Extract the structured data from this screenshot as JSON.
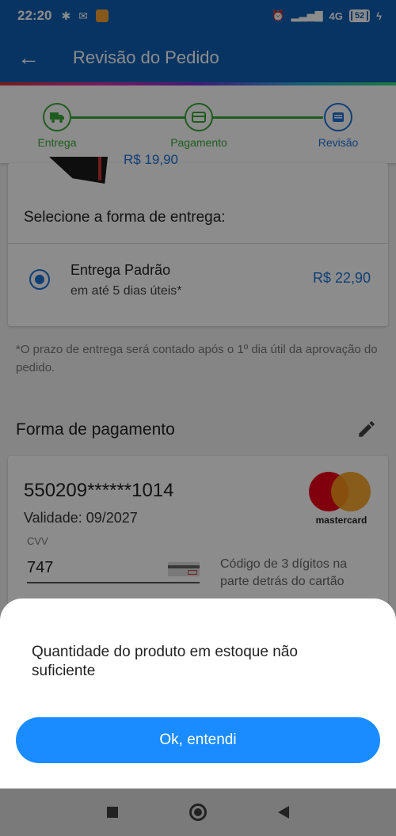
{
  "status_bar": {
    "time": "22:20",
    "network": "4G",
    "battery": "52"
  },
  "app_bar": {
    "title": "Revisão do Pedido"
  },
  "stepper": {
    "steps": [
      {
        "label": "Entrega",
        "state": "done"
      },
      {
        "label": "Pagamento",
        "state": "done"
      },
      {
        "label": "Revisão",
        "state": "current"
      }
    ],
    "colors": {
      "done": "#3aa83a",
      "current": "#1e73d8"
    }
  },
  "delivery": {
    "product_price": "R$ 19,90",
    "heading": "Selecione a forma de entrega:",
    "option": {
      "name": "Entrega Padrão",
      "subtitle": "em até 5 dias úteis*",
      "price": "R$ 22,90",
      "selected": true
    },
    "note": "*O prazo de entrega será contado após o 1º dia útil da aprovação do pedido."
  },
  "payment": {
    "heading": "Forma de pagamento",
    "card_number": "550209******1014",
    "validity": "Validade: 09/2027",
    "cvv_label": "CVV",
    "cvv_value": "747",
    "cvv_hint": "Código de 3 dígitos na parte detrás do cartão",
    "brand": "mastercard"
  },
  "sheet": {
    "message": "Quantidade do produto em estoque não suficiente",
    "button_label": "Ok, entendi"
  },
  "colors": {
    "primary": "#0d5fb3",
    "accent_blue": "#1e73d8",
    "button": "#1a8cff",
    "success": "#3aa83a"
  }
}
